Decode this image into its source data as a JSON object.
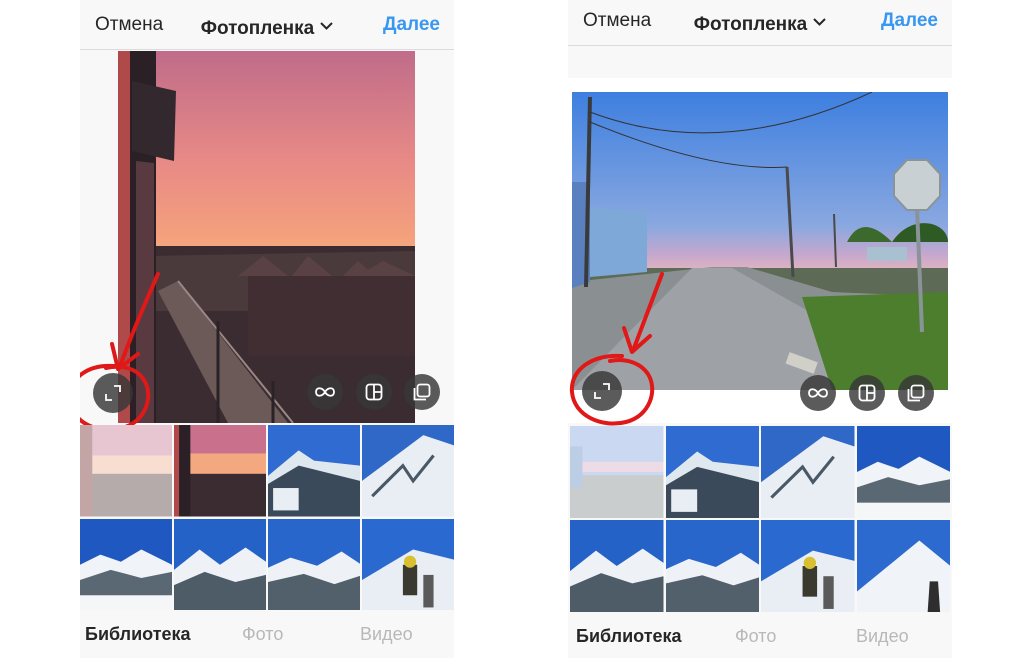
{
  "left": {
    "header": {
      "cancel": "Отмена",
      "source": "Фотопленка",
      "next": "Далее"
    },
    "tabs": [
      {
        "label": "Библиотека"
      },
      {
        "label": "Фото"
      },
      {
        "label": "Видео"
      }
    ],
    "thumbnails": [
      "sunset-faded",
      "sunset-balcony",
      "mountain-bluesky",
      "snow-slope",
      "snow-peaks",
      "peaks-range",
      "peaks-range",
      "skier-mountain"
    ]
  },
  "right": {
    "header": {
      "cancel": "Отмена",
      "source": "Фотопленка",
      "next": "Далее"
    },
    "tabs": [
      {
        "label": "Библиотека"
      },
      {
        "label": "Фото"
      },
      {
        "label": "Видео"
      }
    ],
    "thumbnails": [
      "road-faded",
      "mountain-bluesky",
      "snow-slope",
      "snow-peaks",
      "peaks-range",
      "peaks-range",
      "skier-mountain",
      "snow-peak-tree"
    ]
  },
  "colors": {
    "accent": "#3897f0",
    "text": "#262626",
    "inactive_tab": "#b8b8b8",
    "annotation": "#e01818",
    "tool_bg": "#3a3a3a"
  },
  "icons": [
    "expand-icon",
    "boomerang-icon",
    "layout-icon",
    "multi-select-icon",
    "chevron-down-icon",
    "red-arrow",
    "red-circle"
  ]
}
